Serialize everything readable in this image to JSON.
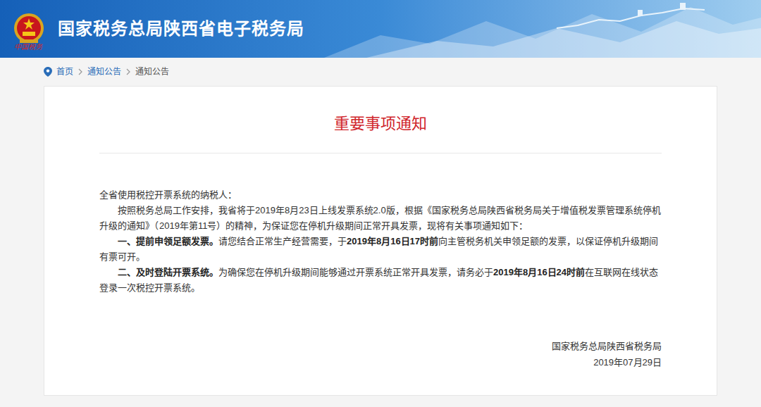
{
  "header": {
    "title": "国家税务总局陕西省电子税务局",
    "logo_caption": "中国税务"
  },
  "breadcrumb": [
    {
      "label": "首页"
    },
    {
      "label": "通知公告"
    },
    {
      "label": "通知公告"
    }
  ],
  "notice": {
    "title": "重要事项通知",
    "salutation": "全省使用税控开票系统的纳税人：",
    "paragraphs": [
      {
        "segments": [
          {
            "text": "按照税务总局工作安排，我省将于2019年8月23日上线发票系统2.0版，根据《国家税务总局陕西省税务局关于增值税发票管理系统停机升级的通知》（2019年第11号）的精神，为保证您在停机升级期间正常开具发票，现将有关事项通知如下：",
            "bold": false
          }
        ]
      },
      {
        "segments": [
          {
            "text": "一、提前申领足额发票。",
            "bold": true
          },
          {
            "text": "请您结合正常生产经营需要，于",
            "bold": false
          },
          {
            "text": "2019年8月16日17时前",
            "bold": true
          },
          {
            "text": "向主管税务机关申领足额的发票，以保证停机升级期间有票可开。",
            "bold": false
          }
        ]
      },
      {
        "segments": [
          {
            "text": "二、及时登陆开票系统。",
            "bold": true
          },
          {
            "text": "为确保您在停机升级期间能够通过开票系统正常开具发票，请务必于",
            "bold": false
          },
          {
            "text": "2019年8月16日24时前",
            "bold": true
          },
          {
            "text": "在互联网在线状态登录一次税控开票系统。",
            "bold": false
          }
        ]
      }
    ],
    "signature": {
      "issuer": "国家税务总局陕西省税务局",
      "date": "2019年07月29日"
    }
  }
}
